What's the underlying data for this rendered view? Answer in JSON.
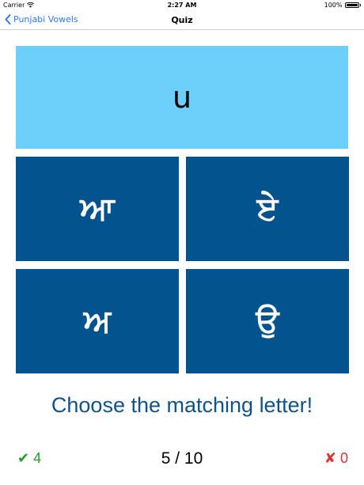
{
  "status_bar": {
    "carrier": "Carrier",
    "time": "2:27 AM",
    "battery_percent": "100%",
    "battery_level": 1.0,
    "wifi_icon": "wifi-icon"
  },
  "nav": {
    "back_label": "Punjabi Vowels",
    "title": "Quiz",
    "back_icon": "chevron-left-icon"
  },
  "quiz": {
    "prompt": "u",
    "options": [
      "ਆ",
      "ਏ",
      "ਅ",
      "ਉ"
    ],
    "instruction": "Choose the matching letter!",
    "progress": "5 / 10",
    "correct_count": "4",
    "wrong_count": "0",
    "correct_icon": "✔",
    "wrong_icon": "✘"
  },
  "colors": {
    "prompt_bg": "#6dd0fb",
    "tile_bg": "#03538f",
    "instruction": "#10538a",
    "correct": "#2c9a2c",
    "wrong": "#dd3333",
    "link": "#2f7bf6"
  }
}
